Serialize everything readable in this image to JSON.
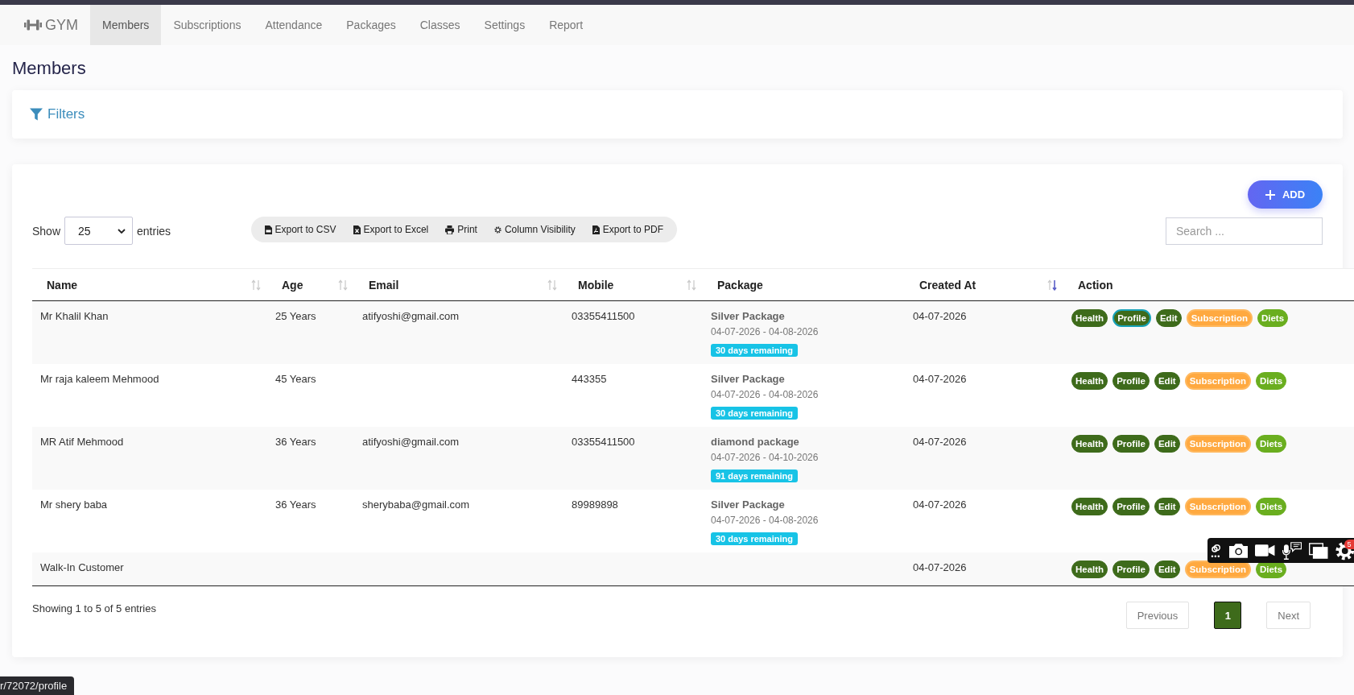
{
  "nav": {
    "brand": "GYM",
    "tabs": [
      {
        "label": "Members",
        "selected": true
      },
      {
        "label": "Subscriptions",
        "selected": false
      },
      {
        "label": "Attendance",
        "selected": false
      },
      {
        "label": "Packages",
        "selected": false
      },
      {
        "label": "Classes",
        "selected": false
      },
      {
        "label": "Settings",
        "selected": false
      },
      {
        "label": "Report",
        "selected": false
      }
    ]
  },
  "page_title": "Members",
  "filters": {
    "label": "Filters"
  },
  "add_button": {
    "label": "ADD"
  },
  "length_menu": {
    "prefix": "Show",
    "value": "25",
    "suffix": "entries"
  },
  "export_buttons": [
    {
      "label": "Export to CSV",
      "kind": "csv"
    },
    {
      "label": "Export to Excel",
      "kind": "excel"
    },
    {
      "label": "Print",
      "kind": "print"
    },
    {
      "label": "Column Visibility",
      "kind": "columns"
    },
    {
      "label": "Export to PDF",
      "kind": "pdf"
    }
  ],
  "search": {
    "placeholder": "Search ..."
  },
  "table": {
    "columns": [
      {
        "label": "Name",
        "sortable": true,
        "sorted_desc": false
      },
      {
        "label": "Age",
        "sortable": true,
        "sorted_desc": false
      },
      {
        "label": "Email",
        "sortable": true,
        "sorted_desc": false
      },
      {
        "label": "Mobile",
        "sortable": true,
        "sorted_desc": false
      },
      {
        "label": "Package",
        "sortable": false
      },
      {
        "label": "Created At",
        "sortable": true,
        "sorted_desc": true
      },
      {
        "label": "Action",
        "sortable": false
      }
    ],
    "rows": [
      {
        "name": "Mr Khalil Khan",
        "age": "25 Years",
        "email": "atifyoshi@gmail.com",
        "mobile": "03355411500",
        "package": {
          "name": "Silver Package",
          "dates": "04-07-2026 - 04-08-2026",
          "remaining": "30 days remaining"
        },
        "created_at": "04-07-2026",
        "actions": [
          {
            "label": "Health",
            "kind": "dark",
            "focused": false
          },
          {
            "label": "Profile",
            "kind": "dark",
            "focused": true
          },
          {
            "label": "Edit",
            "kind": "dark",
            "focused": false
          },
          {
            "label": "Subscription",
            "kind": "warning",
            "focused": false
          },
          {
            "label": "Diets",
            "kind": "success",
            "focused": false
          }
        ]
      },
      {
        "name": "Mr raja kaleem Mehmood",
        "age": "45 Years",
        "mobile": "443355",
        "package": {
          "name": "Silver Package",
          "dates": "04-07-2026 - 04-08-2026",
          "remaining": "30 days remaining"
        },
        "created_at": "04-07-2026",
        "actions": [
          {
            "label": "Health",
            "kind": "dark",
            "focused": false
          },
          {
            "label": "Profile",
            "kind": "dark",
            "focused": false
          },
          {
            "label": "Edit",
            "kind": "dark",
            "focused": false
          },
          {
            "label": "Subscription",
            "kind": "warning",
            "focused": false
          },
          {
            "label": "Diets",
            "kind": "success",
            "focused": false
          }
        ]
      },
      {
        "name": "MR Atif Mehmood",
        "age": "36 Years",
        "email": "atifyoshi@gmail.com",
        "mobile": "03355411500",
        "package": {
          "name": "diamond package",
          "dates": "04-07-2026 - 04-10-2026",
          "remaining": "91 days remaining"
        },
        "created_at": "04-07-2026",
        "actions": [
          {
            "label": "Health",
            "kind": "dark",
            "focused": false
          },
          {
            "label": "Profile",
            "kind": "dark",
            "focused": false
          },
          {
            "label": "Edit",
            "kind": "dark",
            "focused": false
          },
          {
            "label": "Subscription",
            "kind": "warning",
            "focused": false
          },
          {
            "label": "Diets",
            "kind": "success",
            "focused": false
          }
        ]
      },
      {
        "name": "Mr shery baba",
        "age": "36 Years",
        "email": "sherybaba@gmail.com",
        "mobile": "89989898",
        "package": {
          "name": "Silver Package",
          "dates": "04-07-2026 - 04-08-2026",
          "remaining": "30 days remaining"
        },
        "created_at": "04-07-2026",
        "actions": [
          {
            "label": "Health",
            "kind": "dark",
            "focused": false
          },
          {
            "label": "Profile",
            "kind": "dark",
            "focused": false
          },
          {
            "label": "Edit",
            "kind": "dark",
            "focused": false
          },
          {
            "label": "Subscription",
            "kind": "warning",
            "focused": false
          },
          {
            "label": "Diets",
            "kind": "success",
            "focused": false
          }
        ]
      },
      {
        "name": "Walk-In Customer",
        "created_at": "04-07-2026",
        "actions": [
          {
            "label": "Health",
            "kind": "dark",
            "focused": false
          },
          {
            "label": "Profile",
            "kind": "dark",
            "focused": false
          },
          {
            "label": "Edit",
            "kind": "dark",
            "focused": false
          },
          {
            "label": "Subscription",
            "kind": "warning",
            "focused": false
          },
          {
            "label": "Diets",
            "kind": "success",
            "focused": false
          }
        ]
      }
    ]
  },
  "info": "Showing 1 to 5 of 5 entries",
  "pagination": {
    "previous": {
      "label": "Previous",
      "disabled": true
    },
    "pages": [
      {
        "label": "1",
        "selected": true
      }
    ],
    "next": {
      "label": "Next",
      "disabled": true
    }
  },
  "recorder_toolbar": {
    "badge": "5"
  },
  "link_preview": "r/72072/profile"
}
